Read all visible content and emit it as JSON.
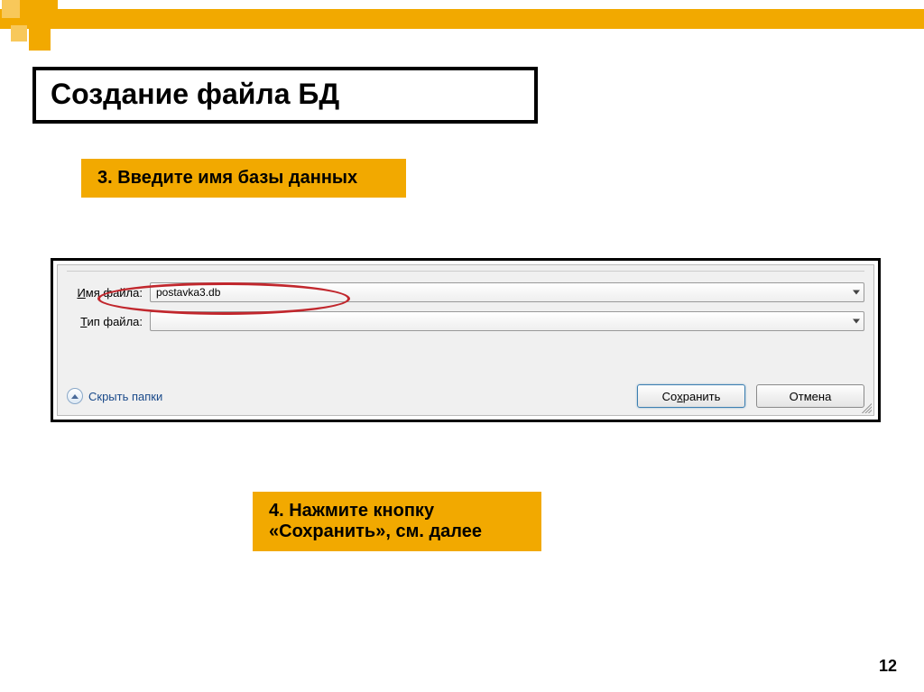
{
  "title": "Создание файла БД",
  "step3": "3. Введите имя базы данных",
  "step4": "4. Нажмите кнопку «Сохранить», см. далее",
  "dialog": {
    "filename_label_pre": "И",
    "filename_label_rest": "мя файла:",
    "filename_value": "postavka3.db",
    "filetype_label_pre": "Т",
    "filetype_label_rest": "ип файла:",
    "filetype_value": "",
    "hide_folders": "Скрыть папки",
    "save_pre": "Со",
    "save_u": "х",
    "save_rest": "ранить",
    "cancel": "Отмена"
  },
  "page": "12"
}
